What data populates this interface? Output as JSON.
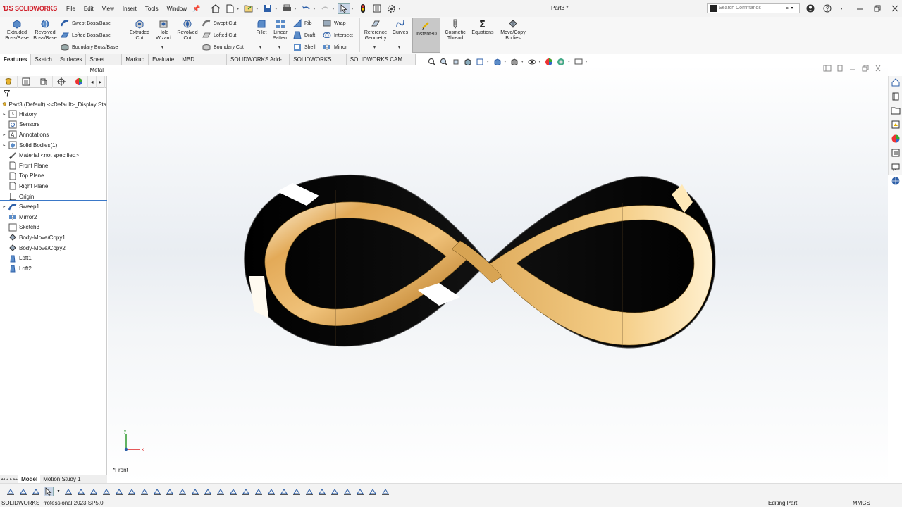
{
  "app": {
    "brand": "SOLIDWORKS",
    "document_title": "Part3 *"
  },
  "menu": [
    "File",
    "Edit",
    "View",
    "Insert",
    "Tools",
    "Window"
  ],
  "search": {
    "placeholder": "Search Commands"
  },
  "ribbon": {
    "extruded_boss": "Extruded Boss/Base",
    "revolved_boss": "Revolved Boss/Base",
    "swept_boss": "Swept Boss/Base",
    "lofted_boss": "Lofted Boss/Base",
    "boundary_boss": "Boundary Boss/Base",
    "extruded_cut": "Extruded Cut",
    "hole_wizard": "Hole Wizard",
    "revolved_cut": "Revolved Cut",
    "swept_cut": "Swept Cut",
    "lofted_cut": "Lofted Cut",
    "boundary_cut": "Boundary Cut",
    "fillet": "Fillet",
    "linear_pattern": "Linear Pattern",
    "rib": "Rib",
    "draft": "Draft",
    "shell": "Shell",
    "wrap": "Wrap",
    "intersect": "Intersect",
    "mirror": "Mirror",
    "reference_geometry": "Reference Geometry",
    "curves": "Curves",
    "instant3d": "Instant3D",
    "cosmetic_thread": "Cosmetic Thread",
    "equations": "Equations",
    "move_copy_bodies": "Move/Copy Bodies"
  },
  "tabs": [
    "Features",
    "Sketch",
    "Surfaces",
    "Sheet Metal",
    "Markup",
    "Evaluate",
    "MBD Dimensions",
    "SOLIDWORKS Add-Ins",
    "SOLIDWORKS CAM",
    "SOLIDWORKS CAM TBM"
  ],
  "tree": {
    "root": "Part3 (Default) <<Default>_Display Sta",
    "items": [
      {
        "label": "History",
        "expandable": true,
        "icon": "history-icon"
      },
      {
        "label": "Sensors",
        "expandable": false,
        "icon": "sensors-icon"
      },
      {
        "label": "Annotations",
        "expandable": true,
        "icon": "annotations-icon"
      },
      {
        "label": "Solid Bodies(1)",
        "expandable": true,
        "icon": "solid-bodies-icon"
      },
      {
        "label": "Material <not specified>",
        "expandable": false,
        "icon": "material-icon"
      },
      {
        "label": "Front Plane",
        "expandable": false,
        "icon": "plane-icon"
      },
      {
        "label": "Top Plane",
        "expandable": false,
        "icon": "plane-icon"
      },
      {
        "label": "Right Plane",
        "expandable": false,
        "icon": "plane-icon"
      },
      {
        "label": "Origin",
        "expandable": false,
        "icon": "origin-icon"
      },
      {
        "label": "Sweep1",
        "expandable": true,
        "icon": "sweep-icon"
      },
      {
        "label": "Mirror2",
        "expandable": false,
        "icon": "mirror-icon"
      },
      {
        "label": "Sketch3",
        "expandable": false,
        "icon": "sketch-icon"
      },
      {
        "label": "Body-Move/Copy1",
        "expandable": false,
        "icon": "move-copy-icon"
      },
      {
        "label": "Body-Move/Copy2",
        "expandable": false,
        "icon": "move-copy-icon"
      },
      {
        "label": "Loft1",
        "expandable": false,
        "icon": "loft-icon"
      },
      {
        "label": "Loft2",
        "expandable": false,
        "icon": "loft-icon"
      }
    ]
  },
  "study_tabs": [
    "Model",
    "Motion Study 1"
  ],
  "viewport": {
    "view_label": "*Front",
    "triad_x": "x",
    "triad_y": "y"
  },
  "status": {
    "version": "SOLIDWORKS Professional 2023 SP5.0",
    "mode": "Editing Part",
    "units": "MMGS"
  },
  "colors": {
    "brand": "#d0202b",
    "gold": "#e8b96a",
    "rollback": "#3a78c8"
  }
}
